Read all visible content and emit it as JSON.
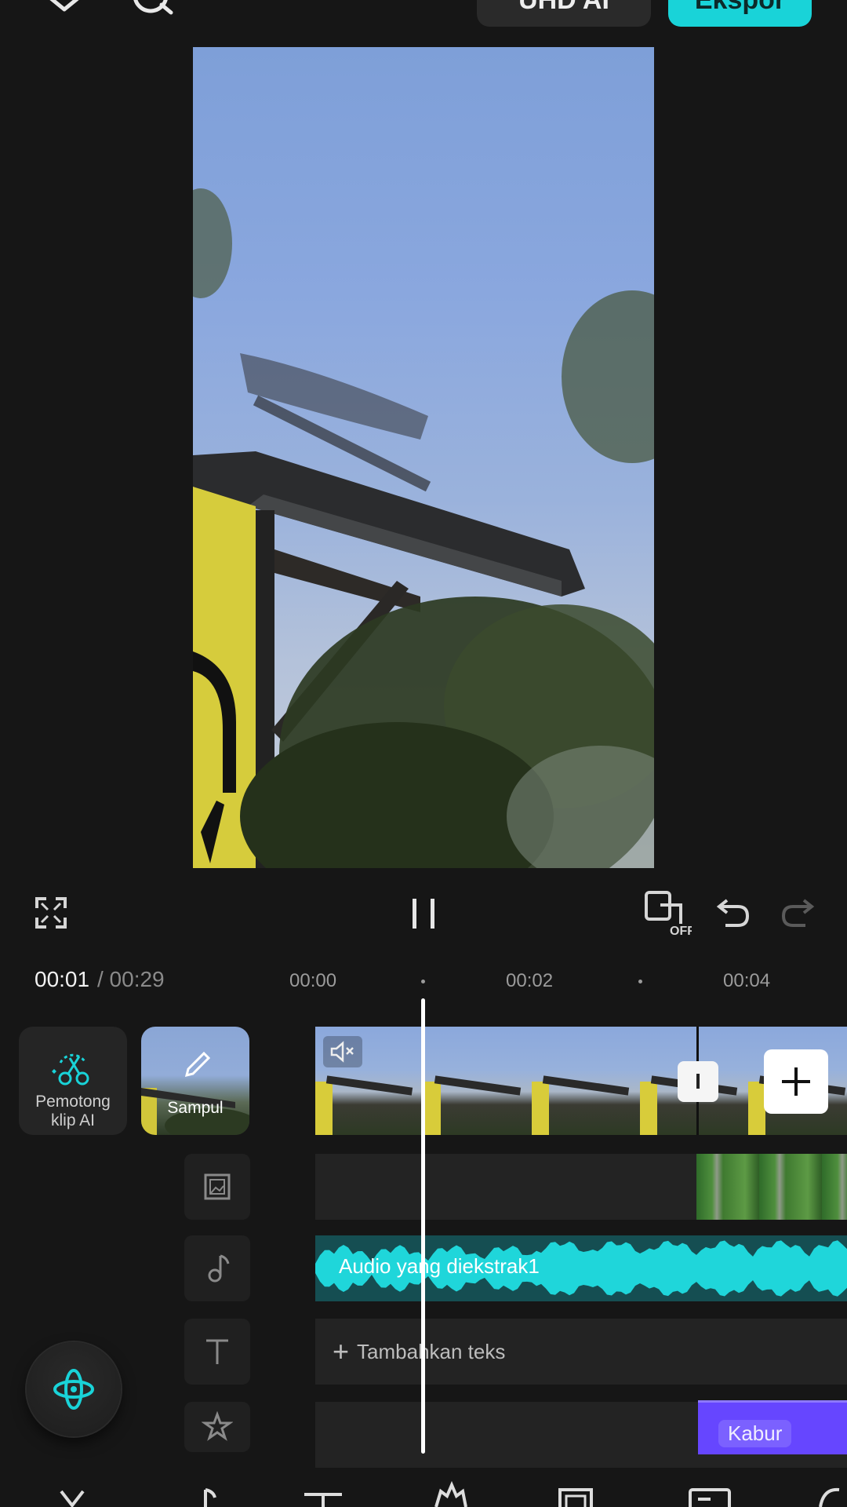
{
  "header": {
    "hd_button_label": "UHD AI",
    "export_button_label": "Ekspor"
  },
  "controls": {
    "mirror_badge": "OFF"
  },
  "timeline": {
    "current_time": "00:01",
    "separator_total": "/ 00:29",
    "ticks": [
      "00:00",
      "00:02",
      "00:04"
    ]
  },
  "tools": {
    "ai_cut_label": "Pemotong klip AI",
    "cover_label": "Sampul"
  },
  "tracks": {
    "audio_label": "Audio yang diekstrak1",
    "add_text_label": "Tambahkan teks",
    "effect_label": "Kabur",
    "cut_marker_label": "I"
  },
  "colors": {
    "accent": "#19d3d8",
    "audio": "#14a7ab",
    "effect": "#6646ff"
  }
}
